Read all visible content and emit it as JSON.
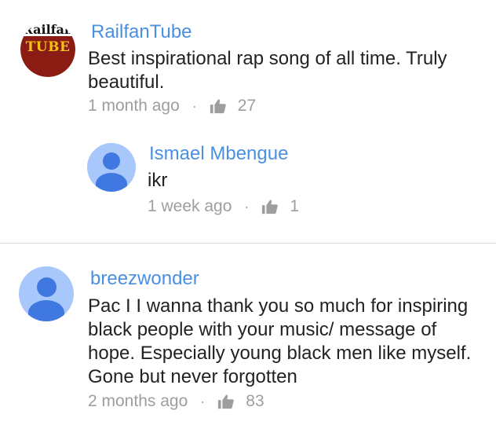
{
  "comments": [
    {
      "author": "RailfanTube",
      "avatar_logo_top": "Railfan",
      "avatar_logo_bottom": "TUBE",
      "text": "Best inspirational rap song of all time. Truly beautiful.",
      "time": "1 month ago",
      "separator": "·",
      "likes": "27",
      "replies": [
        {
          "author": "Ismael Mbengue",
          "text": "ikr",
          "time": "1 week ago",
          "separator": "·",
          "likes": "1"
        }
      ]
    },
    {
      "author": "breezwonder",
      "text": "Pac I I wanna thank you so much for inspiring black people with your music/ message of hope. Especially young black men like myself. Gone but never forgotten",
      "time": "2 months ago",
      "separator": "·",
      "likes": "83"
    }
  ],
  "icons": {
    "like": "thumbs-up-icon",
    "default_avatar": "person-icon"
  },
  "colors": {
    "author": "#4a8fe0",
    "meta": "#9e9e9e",
    "avatar_bg": "#a8c7fa",
    "avatar_fg": "#3f78e0",
    "logo_red": "#8b1c14",
    "logo_yellow": "#f2c21b"
  }
}
